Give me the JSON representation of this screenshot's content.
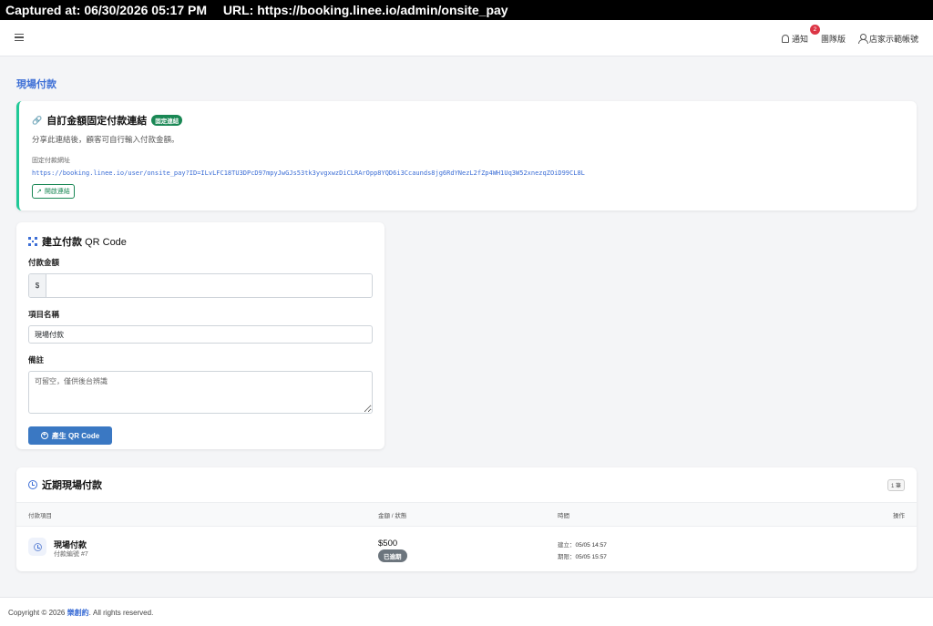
{
  "capture": {
    "captured_text": "Captured at: 06/30/2026 05:17 PM",
    "url_text": "URL: https://booking.linee.io/admin/onsite_pay"
  },
  "topnav": {
    "notifications_label": "通知",
    "notifications_count": "2",
    "team_label": "團隊版",
    "account_label": "店家示範帳號"
  },
  "page": {
    "title": "現場付款"
  },
  "fixed_link": {
    "title": "自訂金額固定付款連結",
    "tag": "固定連結",
    "description": "分享此連結後，顧客可自行輸入付款金額。",
    "url_label": "固定付款網址",
    "url": "https://booking.linee.io/user/onsite_pay?ID=ILvLFC18TU3DPcD97mpyJwGJs53tk3yvgxwzDiCLRArOpp8YQD6i3Ccaunds8jg6RdYNezL2fZp4WH1Uq3W52xnezqZOiD99CL8L",
    "open_button": "開啟連結"
  },
  "qr_form": {
    "title": "建立付款",
    "title_suffix": "QR Code",
    "amount_label": "付款金額",
    "amount_prefix": "$",
    "amount_value": "",
    "item_label": "項目名稱",
    "item_value": "現場付款",
    "note_label": "備註",
    "note_placeholder": "可留空，僅供後台辨識",
    "submit_label": "產生 QR Code"
  },
  "recent": {
    "title": "近期現場付款",
    "count_badge": "1 筆",
    "columns": [
      "付款項目",
      "金額 / 狀態",
      "時間",
      "操作"
    ],
    "rows": [
      {
        "name": "現場付款",
        "sub": "付款編號 #7",
        "amount": "$500",
        "status": "已逾期",
        "created_label": "建立：",
        "created": "05/05 14:57",
        "expire_label": "期限：",
        "expire": "05/05 15:57"
      }
    ]
  },
  "footer": {
    "prefix": "Copyright © 2026",
    "brand": "樂創約",
    "suffix": ". All rights reserved."
  }
}
